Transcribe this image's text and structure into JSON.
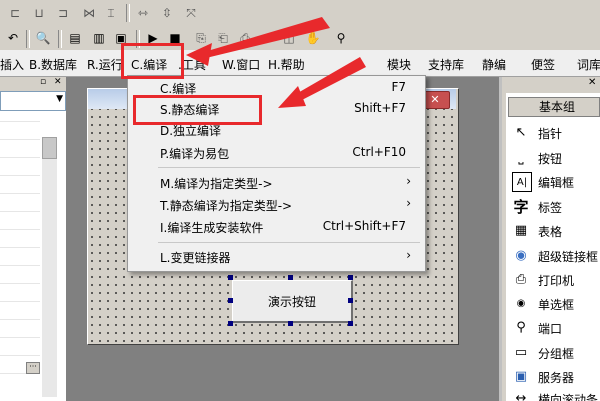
{
  "menubar": {
    "items": [
      {
        "label": "插入"
      },
      {
        "label": "B.数据库"
      },
      {
        "label": "R.运行"
      },
      {
        "label": "C.编译"
      },
      {
        "label": ".工具"
      },
      {
        "label": "W.窗口"
      },
      {
        "label": "H.帮助"
      }
    ],
    "right_items": [
      {
        "label": "模块"
      },
      {
        "label": "支持库"
      },
      {
        "label": "静编"
      },
      {
        "label": "便签"
      },
      {
        "label": "词库"
      }
    ]
  },
  "compile_menu": {
    "items": [
      {
        "label": "C.编译",
        "shortcut": "F7"
      },
      {
        "label": "S.静态编译",
        "shortcut": "Shift+F7"
      },
      {
        "label": "D.独立编译",
        "shortcut": ""
      },
      {
        "label": "P.编译为易包",
        "shortcut": "Ctrl+F10"
      },
      {
        "label": "M.编译为指定类型->",
        "submenu": true
      },
      {
        "label": "T.静态编译为指定类型->",
        "submenu": true
      },
      {
        "label": "I.编译生成安装软件",
        "shortcut": "Ctrl+Shift+F7"
      },
      {
        "label": "L.变更链接器",
        "submenu": true
      }
    ]
  },
  "design": {
    "button_label": "演示按钮",
    "close_glyph": "✕"
  },
  "components": {
    "header": "基本组",
    "items": [
      {
        "label": "指针",
        "icon": "↖"
      },
      {
        "label": "按钮",
        "icon": "⎵"
      },
      {
        "label": "编辑框",
        "icon": "A|"
      },
      {
        "label": "标签",
        "icon": "字"
      },
      {
        "label": "表格",
        "icon": "▦"
      },
      {
        "label": "超级链接框",
        "icon": "◉"
      },
      {
        "label": "打印机",
        "icon": "⎙"
      },
      {
        "label": "单选框",
        "icon": "◉"
      },
      {
        "label": "端口",
        "icon": "⚲"
      },
      {
        "label": "分组框",
        "icon": "▭"
      },
      {
        "label": "服务器",
        "icon": "▣"
      },
      {
        "label": "横向滚动条",
        "icon": "↔"
      }
    ]
  },
  "colors": {
    "annotation": "#e8292c"
  }
}
